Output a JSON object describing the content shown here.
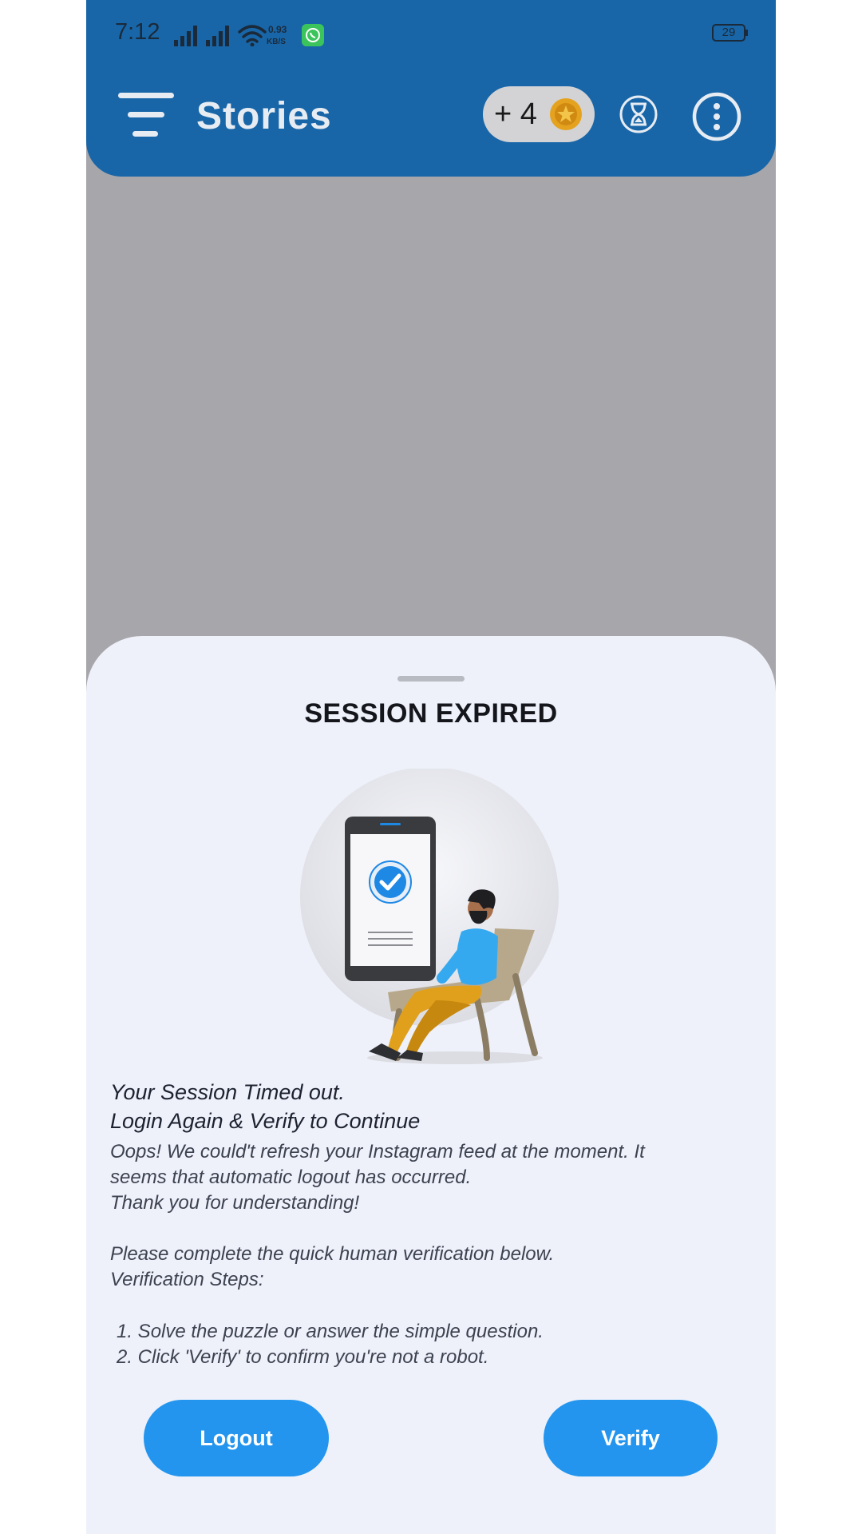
{
  "status_bar": {
    "time": "7:12",
    "network_speed_value": "0.93",
    "network_speed_unit": "KB/S",
    "battery": "29"
  },
  "app_bar": {
    "title": "Stories",
    "coins_text": "+ 4",
    "icons": [
      "menu-icon",
      "coin-icon",
      "hourglass-icon",
      "more-vertical-icon"
    ]
  },
  "sheet": {
    "title": "SESSION EXPIRED",
    "heading_line1": "Your Session Timed out.",
    "heading_line2": "Login Again & Verify to Continue",
    "body_line1": "Oops! We could't refresh your Instagram feed at the moment. It",
    "body_line2": "seems that automatic logout has occurred.",
    "body_line3": "Thank you for understanding!",
    "body_line4": "Please complete the quick human verification below.",
    "body_line5": "Verification Steps:",
    "step1": "1. Solve the puzzle or answer the simple question.",
    "step2": "2. Click 'Verify' to confirm you're not a robot.",
    "logout_label": "Logout",
    "verify_label": "Verify"
  },
  "colors": {
    "app_bar": "#1866a8",
    "overlay": "#a7a6aa",
    "sheet_bg": "#eef1fa",
    "button": "#2395ee"
  }
}
